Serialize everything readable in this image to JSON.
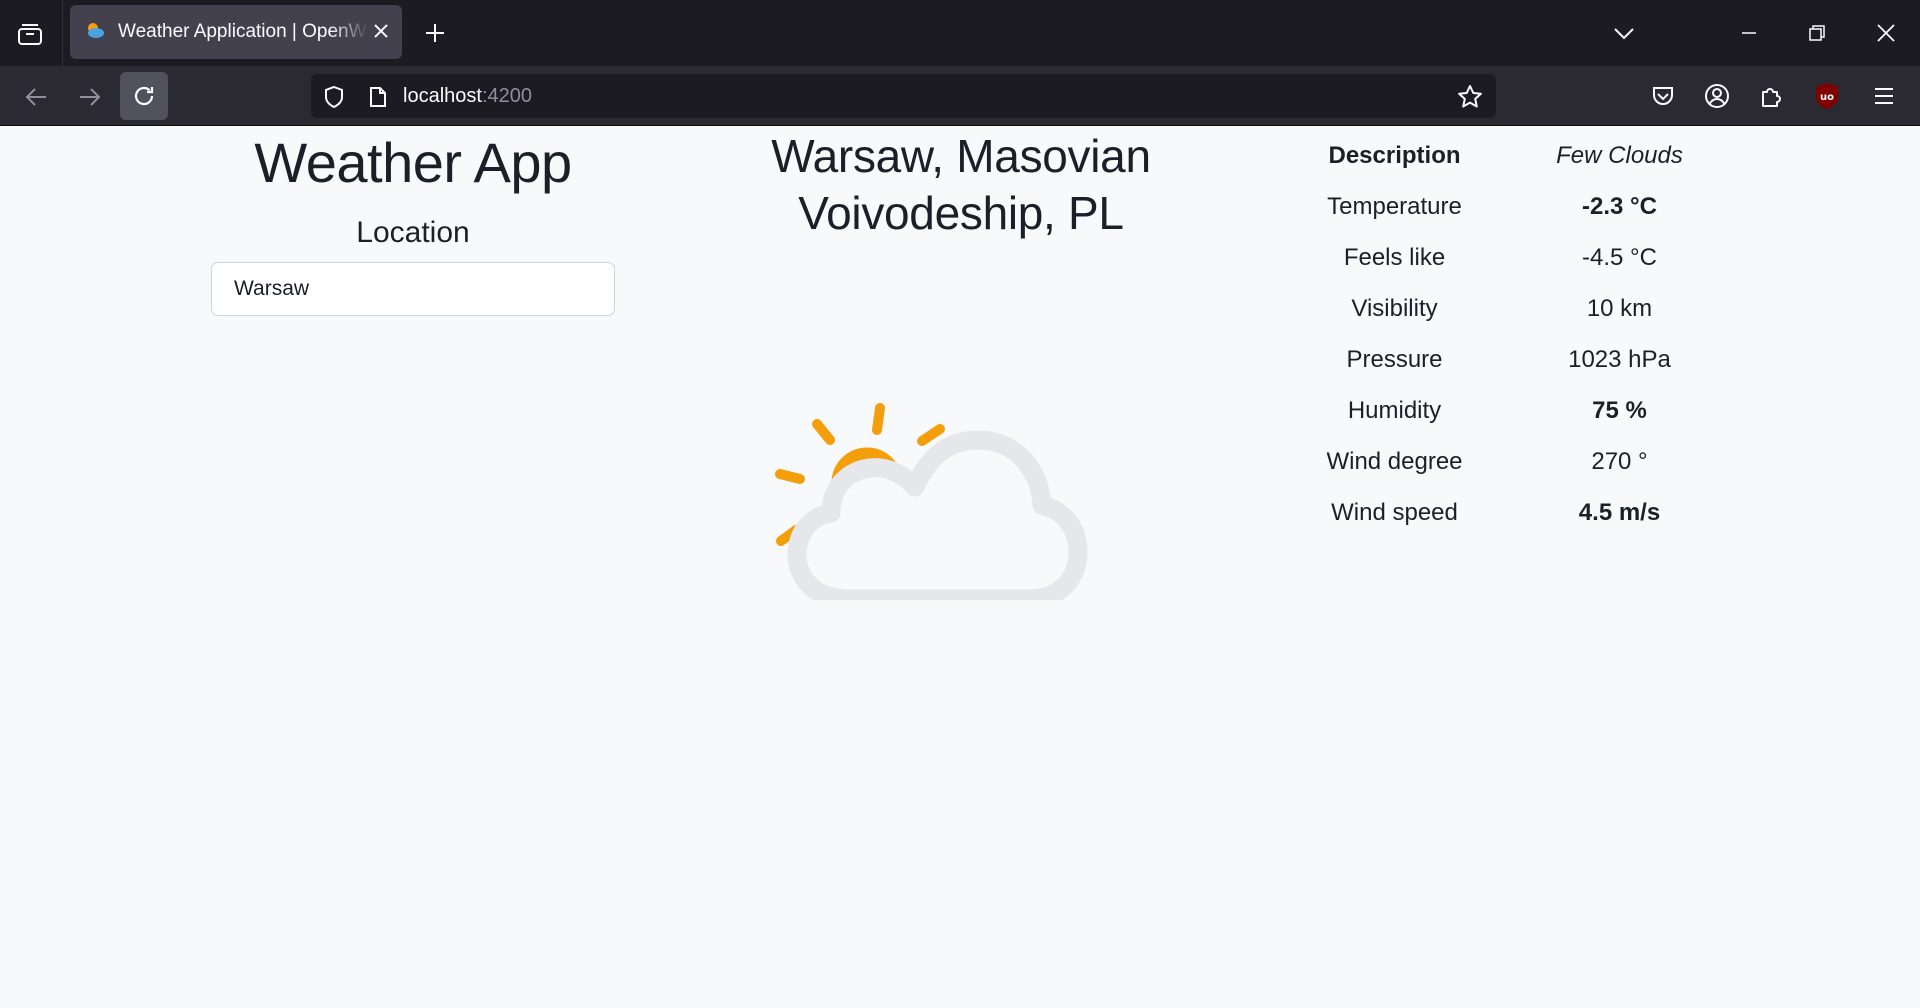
{
  "browser": {
    "tab_title": "Weather Application | OpenWeather",
    "url_host": "localhost",
    "url_port": ":4200"
  },
  "app": {
    "title": "Weather App",
    "location_label": "Location",
    "location_value": "Warsaw"
  },
  "weather": {
    "city_line1": "Warsaw, Masovian",
    "city_line2": "Voivodeship, PL",
    "icon": "few-clouds-icon",
    "colors": {
      "sun": "#f59e0b",
      "cloud": "#e5e7eb"
    }
  },
  "details": {
    "description_label": "Description",
    "description_value": "Few Clouds",
    "temperature_label": "Temperature",
    "temperature_value": "-2.3 °C",
    "feels_like_label": "Feels like",
    "feels_like_value": "-4.5 °C",
    "visibility_label": "Visibility",
    "visibility_value": "10 km",
    "pressure_label": "Pressure",
    "pressure_value": "1023 hPa",
    "humidity_label": "Humidity",
    "humidity_value": "75 %",
    "wind_degree_label": "Wind degree",
    "wind_degree_value": "270 °",
    "wind_speed_label": "Wind speed",
    "wind_speed_value": "4.5 m/s"
  }
}
